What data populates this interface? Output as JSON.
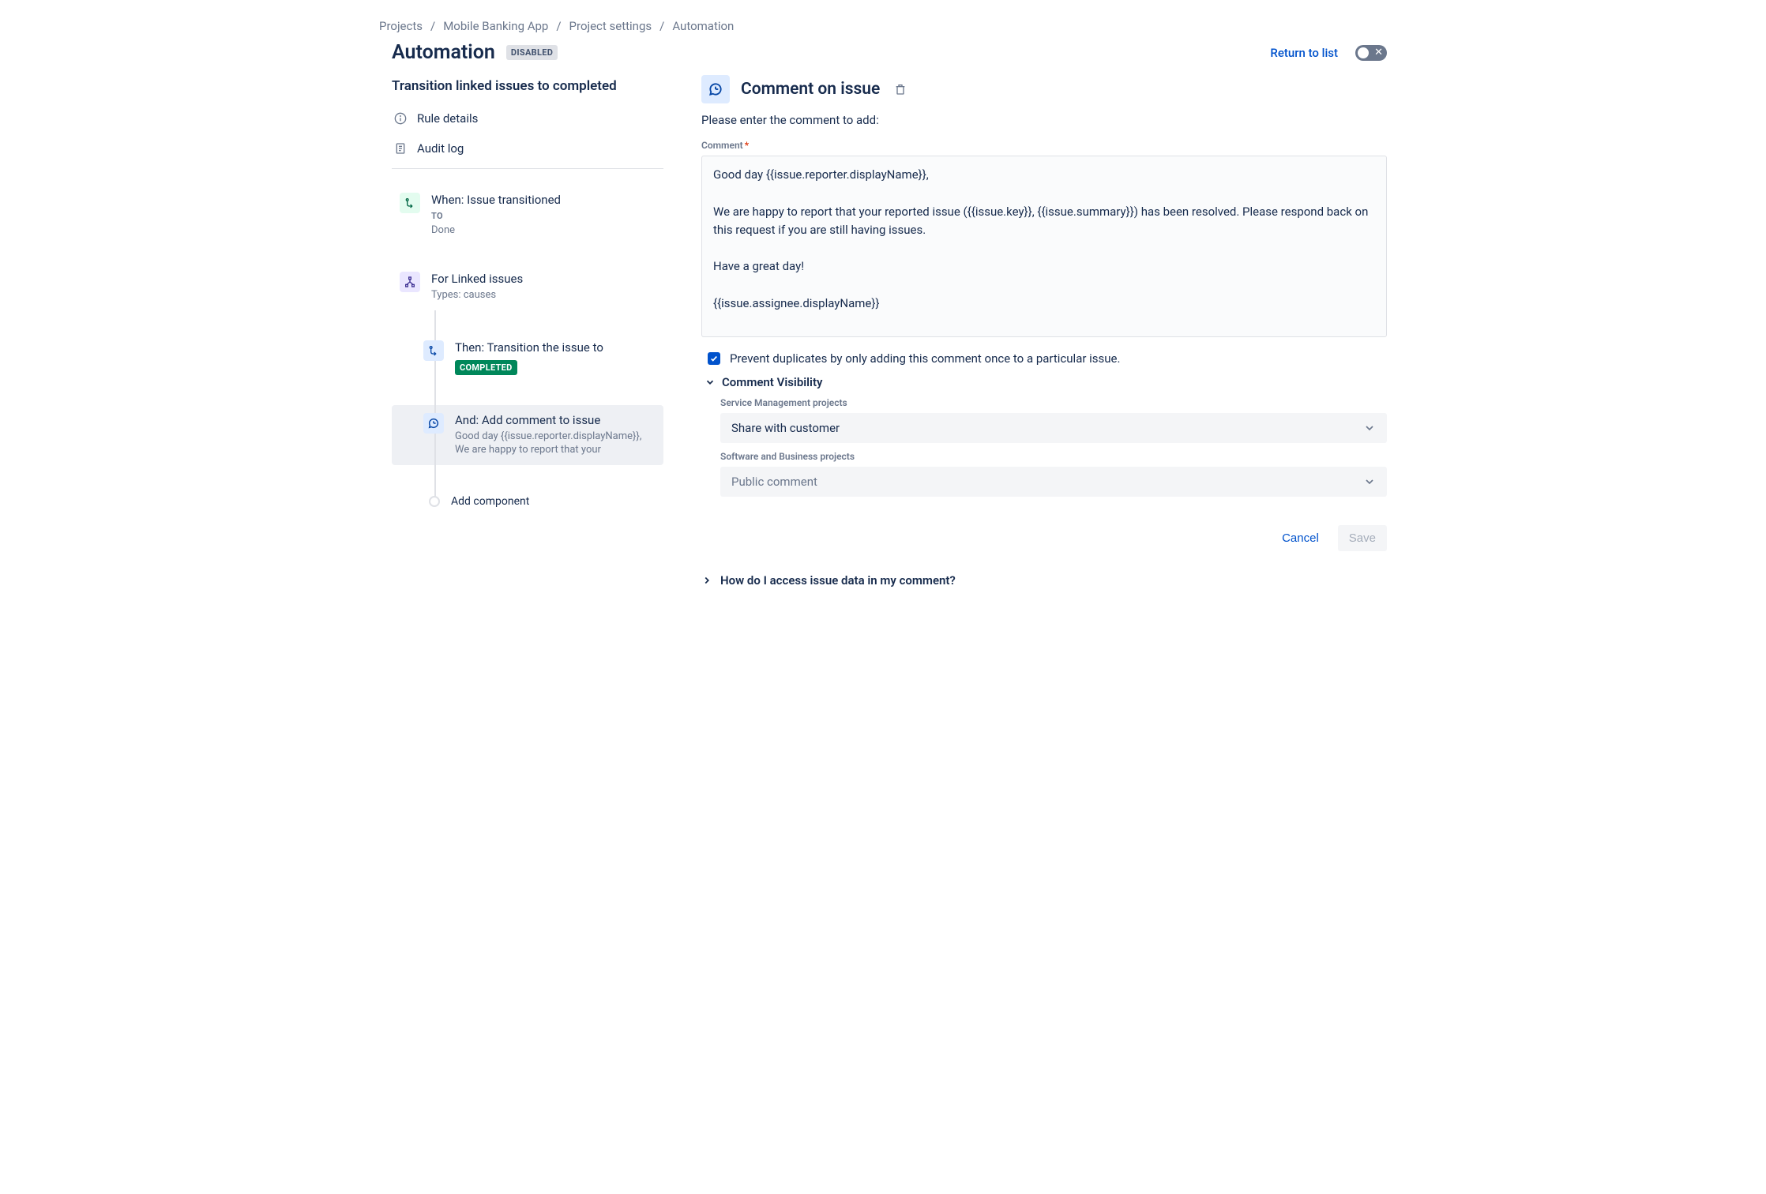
{
  "breadcrumbs": [
    "Projects",
    "Mobile Banking App",
    "Project settings",
    "Automation"
  ],
  "page": {
    "title": "Automation",
    "status_lozenge": "DISABLED",
    "return_link": "Return to list"
  },
  "sidebar": {
    "rule_name": "Transition linked issues to completed",
    "nav": {
      "rule_details": "Rule details",
      "audit_log": "Audit log"
    },
    "chain": {
      "trigger": {
        "title": "When: Issue transitioned",
        "to_label": "TO",
        "to_value": "Done"
      },
      "branch": {
        "title": "For Linked issues",
        "subtitle": "Types: causes"
      },
      "action_transition": {
        "title": "Then: Transition the issue to",
        "status_lozenge": "COMPLETED"
      },
      "action_comment": {
        "title": "And: Add comment to issue",
        "preview": "Good day {{issue.reporter.displayName}}, We are happy to report that your"
      },
      "add_component": "Add component"
    }
  },
  "panel": {
    "title": "Comment on issue",
    "description": "Please enter the comment to add:",
    "comment_label": "Comment",
    "comment_value": "Good day {{issue.reporter.displayName}},\n\nWe are happy to report that your reported issue ({{issue.key}}, {{issue.summary}}) has been resolved. Please respond back on this request if you are still having issues.\n\nHave a great day!\n\n{{issue.assignee.displayName}}",
    "prevent_duplicates_label": "Prevent duplicates by only adding this comment once to a particular issue.",
    "visibility": {
      "section_title": "Comment Visibility",
      "sm_label": "Service Management projects",
      "sm_value": "Share with customer",
      "sw_label": "Software and Business projects",
      "sw_value": "Public comment"
    },
    "actions": {
      "cancel": "Cancel",
      "save": "Save"
    },
    "help": "How do I access issue data in my comment?"
  }
}
